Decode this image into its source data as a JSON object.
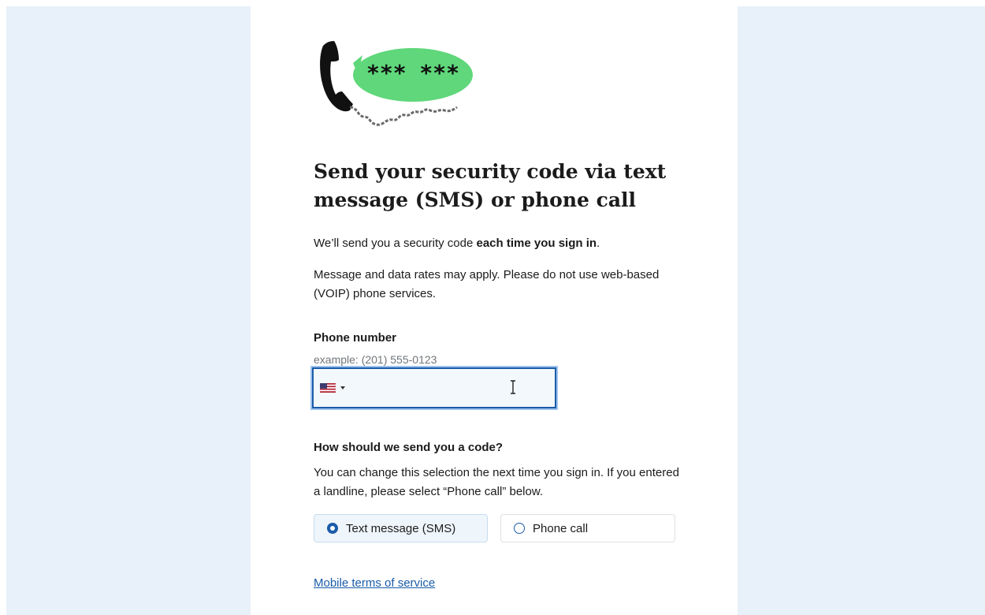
{
  "page": {
    "title": "Send your security code via text message (SMS) or phone call",
    "intro_prefix": "We’ll send you a security code ",
    "intro_bold": "each time you sign in",
    "intro_suffix": ".",
    "rates_notice": "Message and data rates may apply. Please do not use web-based (VOIP) phone services."
  },
  "hero": {
    "icon": "phone-with-speech-bubble-icon",
    "masked_code": "*** ***",
    "bubble_color": "#5fd77a"
  },
  "phone": {
    "label": "Phone number",
    "hint": "example: (201) 555-0123",
    "value": "",
    "country_icon": "us-flag-icon"
  },
  "delivery": {
    "label": "How should we send you a code?",
    "help": "You can change this selection the next time you sign in. If you entered a landline, please select “Phone call” below.",
    "options": [
      {
        "label": "Text message (SMS)",
        "selected": true
      },
      {
        "label": "Phone call",
        "selected": false
      }
    ]
  },
  "links": {
    "terms": "Mobile terms of service"
  },
  "colors": {
    "page_background": "#e8f1f9",
    "accent": "#1a5ca8",
    "bubble": "#5fd77a"
  }
}
